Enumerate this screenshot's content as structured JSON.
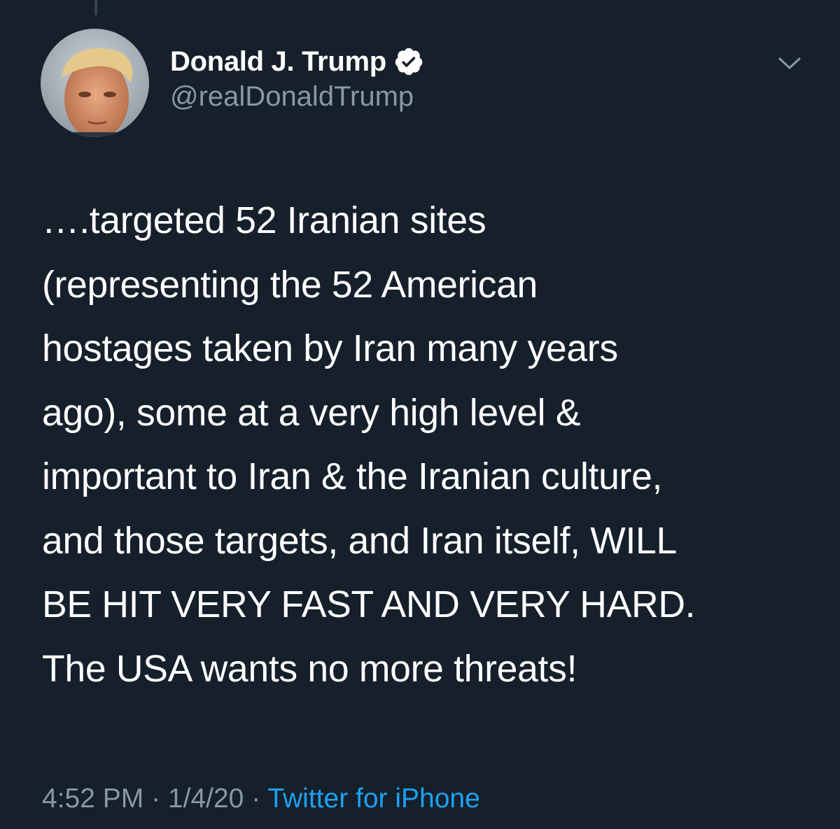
{
  "author": {
    "name": "Donald J. Trump",
    "handle": "@realDonaldTrump",
    "verified": true,
    "avatar_icon": "profile-photo"
  },
  "menu_icon": "chevron-down-icon",
  "tweet": {
    "text": "….targeted 52 Iranian sites\n(representing the 52 American\nhostages taken by Iran many years\nago), some at a very high level &\nimportant to Iran &  the Iranian culture,\nand those targets, and Iran itself, WILL\nBE HIT VERY FAST AND VERY HARD.\nThe USA wants no more threats!"
  },
  "meta": {
    "time": "4:52 PM",
    "separator": " · ",
    "date": "1/4/20",
    "source": "Twitter for iPhone"
  },
  "colors": {
    "background": "#15202b",
    "text": "#ffffff",
    "secondary_text": "#8899a6",
    "accent": "#1da1f2"
  }
}
